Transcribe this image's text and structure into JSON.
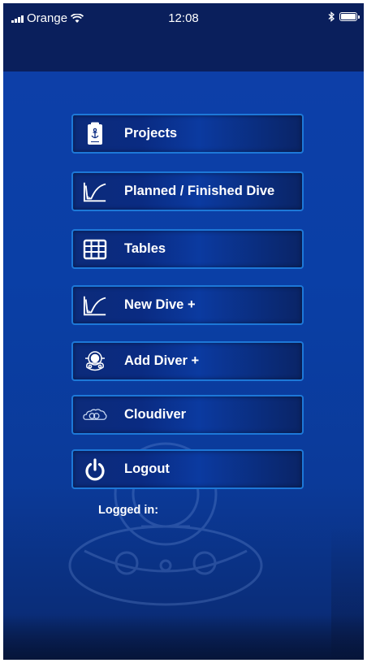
{
  "status_bar": {
    "carrier": "Orange",
    "time": "12:08",
    "signal_icon": "signal-bars-icon",
    "wifi_icon": "wifi-icon",
    "bluetooth_icon": "bluetooth-icon",
    "battery_icon": "battery-icon"
  },
  "menu": {
    "items": [
      {
        "label": "Projects",
        "icon": "project-anchor-icon"
      },
      {
        "label": "Planned / Finished Dive",
        "icon": "dive-profile-icon"
      },
      {
        "label": "Tables",
        "icon": "table-grid-icon"
      },
      {
        "label": "New Dive +",
        "icon": "dive-profile-icon"
      },
      {
        "label": "Add Diver +",
        "icon": "diver-helmet-icon"
      },
      {
        "label": "Cloudiver",
        "icon": "cloud-icon"
      },
      {
        "label": "Logout",
        "icon": "power-icon"
      }
    ]
  },
  "logged_in_label": "Logged in:",
  "colors": {
    "header": "#0a1f5c",
    "background": "#0d3fa8",
    "button_border": "#1d78d8",
    "button_fill": "#0c2b7a",
    "text": "#ffffff"
  }
}
